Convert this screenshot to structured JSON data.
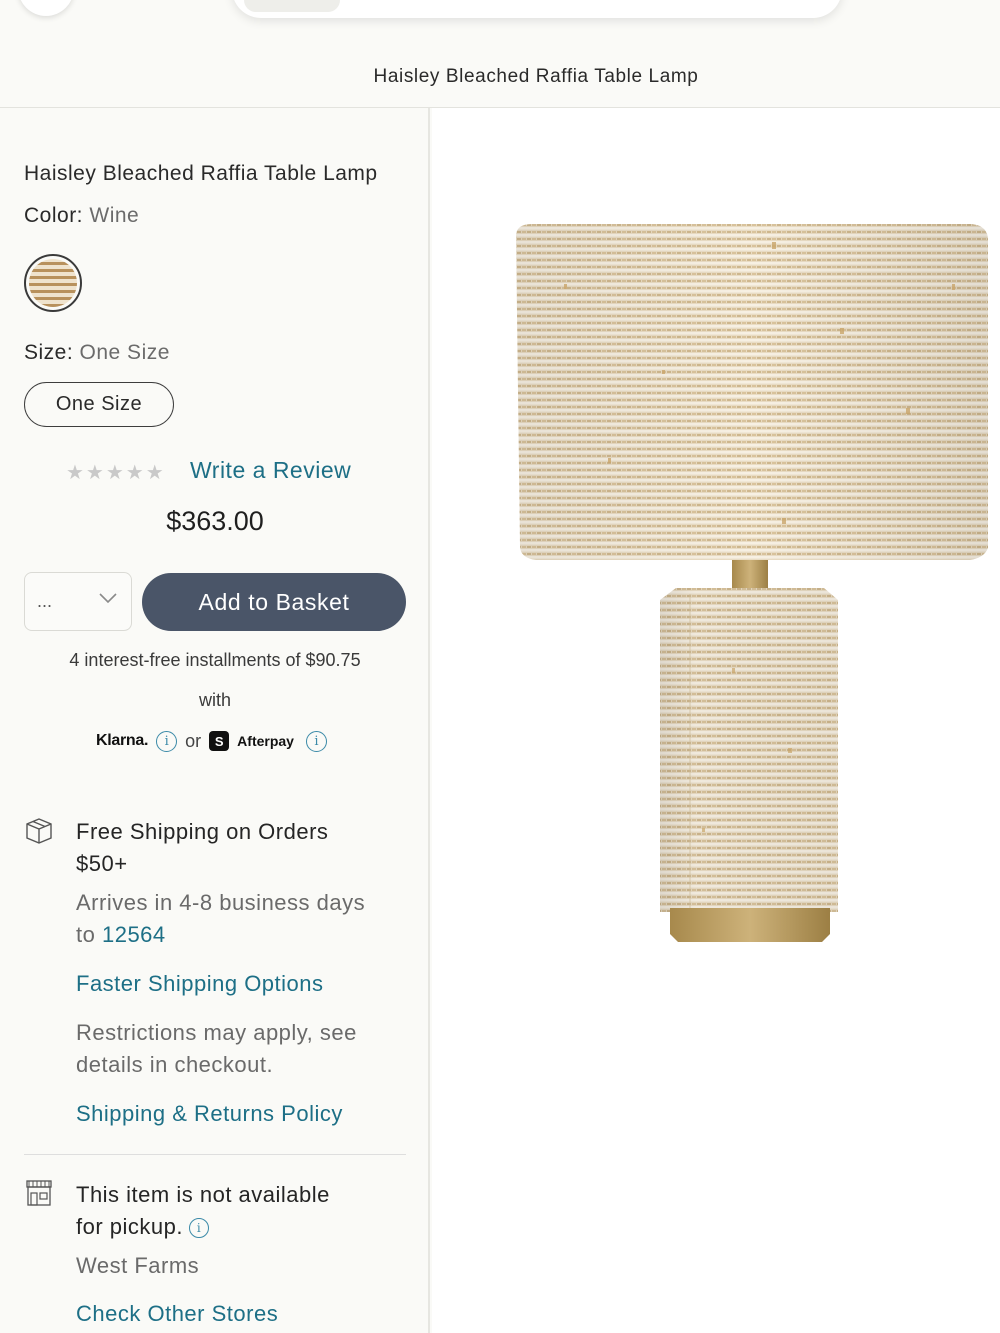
{
  "page": {
    "title": "Haisley Bleached Raffia Table Lamp"
  },
  "product": {
    "name": "Haisley Bleached Raffia Table Lamp",
    "color_label": "Color:",
    "color_value": "Wine",
    "size_label": "Size:",
    "size_value": "One Size",
    "size_option": "One Size",
    "rating_stars": "★★★★★",
    "rating_value": 0,
    "write_review": "Write a Review",
    "price": "$363.00",
    "quantity_value": "...",
    "add_to_basket": "Add to Basket"
  },
  "payments": {
    "installments_text": "4 interest-free installments of $90.75",
    "with_text": "with",
    "klarna": "Klarna.",
    "or": "or",
    "afterpay_badge": "S",
    "afterpay": "Afterpay",
    "info_glyph": "i"
  },
  "shipping": {
    "title_line1": "Free Shipping on Orders",
    "title_line2": "$50+",
    "arrives_line1": "Arrives in 4-8 business days",
    "arrives_prefix": "to ",
    "zip": "12564",
    "faster_link": "Faster Shipping Options",
    "restrictions_line1": "Restrictions may apply, see",
    "restrictions_line2": "details in checkout.",
    "policy_link": "Shipping & Returns Policy"
  },
  "pickup": {
    "line1": "This item is not available",
    "line2": "for pickup.",
    "store": "West Farms",
    "check_link": "Check Other Stores"
  },
  "icons": {
    "shipping": "box-icon",
    "pickup": "store-icon",
    "info": "info-icon",
    "chevron": "chevron-down-icon"
  },
  "colors": {
    "accent_link": "#1d6f86",
    "button_bg": "#4a5568",
    "background": "#fafaf7"
  }
}
